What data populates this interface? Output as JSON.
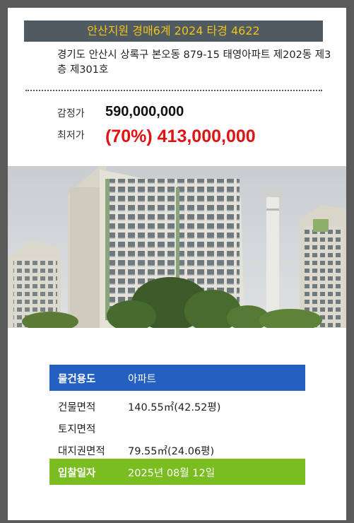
{
  "header": {
    "title": "안산지원 경매6계 2024 타경 4622"
  },
  "property": {
    "address": "경기도 안산시 상록구 본오동 879-15 태영아파트 제202동 제3층 제301호"
  },
  "price": {
    "appraisal_label": "감정가",
    "appraisal_value": "590,000,000",
    "minimum_label": "최저가",
    "minimum_value": "(70%) 413,000,000"
  },
  "photo": {
    "icon": "apartment-building-photo"
  },
  "details": [
    {
      "label": "물건용도",
      "value": "아파트"
    },
    {
      "label": "건물면적",
      "value": "140.55㎡(42.52평)"
    },
    {
      "label": "토지면적",
      "value": ""
    },
    {
      "label": "대지권면적",
      "value": "79.55㎡(24.06평)"
    },
    {
      "label": "입찰일자",
      "value": "2025년 08월 12일"
    }
  ],
  "colors": {
    "title_bg": "#505a61",
    "title_text": "#f1c21b",
    "minimum_price": "#e01313",
    "row_blue": "#2460bf",
    "row_green": "#7abd20"
  }
}
